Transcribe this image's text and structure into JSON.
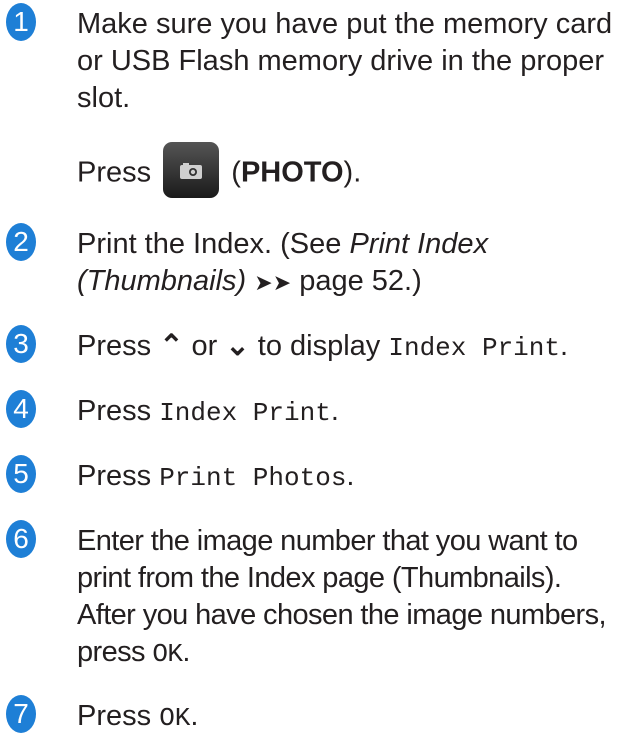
{
  "steps": [
    {
      "num": "1",
      "text": "Make sure you have put the memory card or USB Flash memory drive in the proper slot.",
      "press": "Press",
      "button": "PHOTO",
      "open": "(",
      "close": ")."
    },
    {
      "num": "2",
      "pre": "Print the Index. (See ",
      "ref": "Print Index (Thumbnails)",
      "arrows": "➤➤",
      "post": " page 52.)"
    },
    {
      "num": "3",
      "pre": "Press ",
      "up": "⌃",
      "mid": " or ",
      "down": "⌄",
      "post": " to display ",
      "menu": "Index Print",
      "end": "."
    },
    {
      "num": "4",
      "pre": "Press ",
      "menu": "Index Print",
      "end": "."
    },
    {
      "num": "5",
      "pre": "Press ",
      "menu": "Print Photos",
      "end": "."
    },
    {
      "num": "6",
      "pre": "Enter the image number that you want to print from the Index page (Thumbnails). After you have chosen the image numbers, press ",
      "menu": "OK",
      "end": "."
    },
    {
      "num": "7",
      "pre": "Press ",
      "menu": "OK",
      "end": "."
    }
  ],
  "colors": {
    "step_circle": "#1e7fd6",
    "text": "#231f20"
  }
}
